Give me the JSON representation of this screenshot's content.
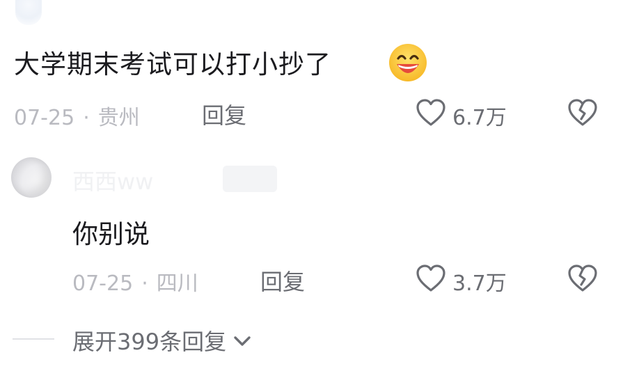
{
  "comment": {
    "text": "大学期末考试可以打小抄了",
    "emoji": "grinning-face-emoji",
    "date": "07-25",
    "separator": "·",
    "location": "贵州",
    "reply_label": "回复",
    "like_count": "6.7万"
  },
  "reply": {
    "username": "西西ww",
    "text": "你别说",
    "date": "07-25",
    "separator": "·",
    "location": "四川",
    "reply_label": "回复",
    "like_count": "3.7万"
  },
  "expand": {
    "label": "展开399条回复"
  },
  "colors": {
    "text_primary": "#1b1b1f",
    "text_meta": "#b9bac0",
    "text_action": "#6b6d73",
    "emoji_face": "#f7b928",
    "emoji_mouth": "#e64b3b"
  }
}
